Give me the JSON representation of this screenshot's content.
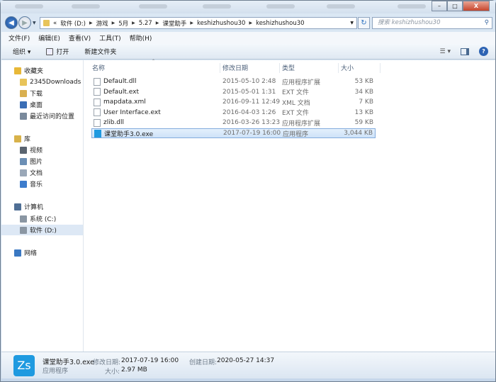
{
  "window": {
    "minimize": "–",
    "maximize": "□",
    "close": "X"
  },
  "address": {
    "prefix": "«",
    "crumbs": [
      "软件 (D:)",
      "游戏",
      "5月",
      "5.27",
      "课堂助手",
      "keshizhushou30",
      "keshizhushou30"
    ]
  },
  "search": {
    "placeholder": "搜索 keshizhushou30"
  },
  "menu": [
    "文件(F)",
    "编辑(E)",
    "查看(V)",
    "工具(T)",
    "帮助(H)"
  ],
  "toolbar": {
    "organize": "组织 ▾",
    "open": "打开",
    "new_folder": "新建文件夹"
  },
  "sidebar": [
    {
      "label": "收藏夹",
      "icon": "star-icon",
      "color": "#e8b838"
    },
    {
      "label": "2345Downloads",
      "icon": "folder-icon",
      "color": "#e8c45a"
    },
    {
      "label": "下载",
      "icon": "download-icon",
      "color": "#d9b050"
    },
    {
      "label": "桌面",
      "icon": "desktop-icon",
      "color": "#3b6eb5"
    },
    {
      "label": "最近访问的位置",
      "icon": "recent-icon",
      "color": "#7a8a9c"
    },
    {
      "label": "库",
      "icon": "library-icon",
      "color": "#d8b24a"
    },
    {
      "label": "视频",
      "icon": "video-icon",
      "color": "#5a6470"
    },
    {
      "label": "图片",
      "icon": "pictures-icon",
      "color": "#6c8fb5"
    },
    {
      "label": "文档",
      "icon": "documents-icon",
      "color": "#9aa8b8"
    },
    {
      "label": "音乐",
      "icon": "music-icon",
      "color": "#3d7ccc"
    },
    {
      "label": "计算机",
      "icon": "computer-icon",
      "color": "#4f6f95"
    },
    {
      "label": "系统 (C:)",
      "icon": "drive-icon",
      "color": "#8a96a3"
    },
    {
      "label": "软件 (D:)",
      "icon": "drive-icon",
      "color": "#8a96a3"
    },
    {
      "label": "网络",
      "icon": "network-icon",
      "color": "#3a78c2"
    }
  ],
  "columns": {
    "name": "名称",
    "date": "修改日期",
    "type": "类型",
    "size": "大小"
  },
  "files": [
    {
      "name": "Default.dll",
      "date": "2015-05-10 2:48",
      "type": "应用程序扩展",
      "size": "53 KB"
    },
    {
      "name": "Default.ext",
      "date": "2015-05-01 1:31",
      "type": "EXT 文件",
      "size": "34 KB"
    },
    {
      "name": "mapdata.xml",
      "date": "2016-09-11 12:49",
      "type": "XML 文档",
      "size": "7 KB"
    },
    {
      "name": "User Interface.ext",
      "date": "2016-04-03 1:26",
      "type": "EXT 文件",
      "size": "13 KB"
    },
    {
      "name": "zlib.dll",
      "date": "2016-03-26 13:23",
      "type": "应用程序扩展",
      "size": "59 KB"
    },
    {
      "name": "课堂助手3.0.exe",
      "date": "2017-07-19 16:00",
      "type": "应用程序",
      "size": "3,044 KB"
    }
  ],
  "details": {
    "icon_text": "Zs",
    "name": "课堂助手3.0.exe",
    "kind": "应用程序",
    "modified_label": "修改日期:",
    "modified": "2017-07-19 16:00",
    "created_label": "创建日期:",
    "created": "2020-05-27 14:37",
    "size_label": "大小:",
    "size": "2.97 MB"
  }
}
